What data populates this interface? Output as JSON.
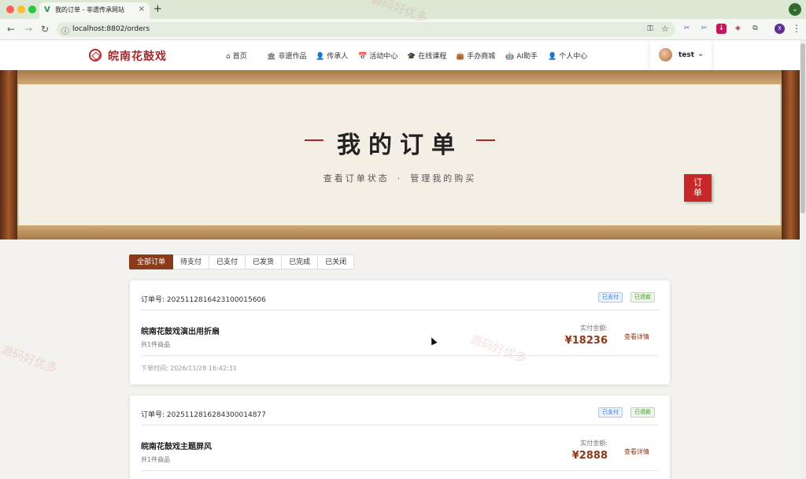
{
  "browser": {
    "tab_title": "我的订单 - 非遗传承网站",
    "tab_favicon": "V",
    "url": "localhost:8802/orders",
    "profile_initial": "X"
  },
  "header": {
    "logo_text": "皖南花鼓戏",
    "nav": [
      {
        "label": "首页",
        "icon": "⌂"
      },
      {
        "label": "非遗作品",
        "icon": "🏛"
      },
      {
        "label": "传承人",
        "icon": "👤"
      },
      {
        "label": "活动中心",
        "icon": "📅"
      },
      {
        "label": "在线课程",
        "icon": "🎓"
      },
      {
        "label": "手办商城",
        "icon": "👜"
      },
      {
        "label": "AI助手",
        "icon": "🤖"
      },
      {
        "label": "个人中心",
        "icon": "👤"
      }
    ],
    "username": "test"
  },
  "hero": {
    "title": "我的订单",
    "subtitle_left": "查看订单状态",
    "subtitle_sep": "·",
    "subtitle_right": "管理我的购买",
    "seal_line1": "订",
    "seal_line2": "单"
  },
  "filters": [
    "全部订单",
    "待支付",
    "已支付",
    "已发货",
    "已完成",
    "已关闭"
  ],
  "active_filter": "全部订单",
  "orders": [
    {
      "order_no": "订单号: 2025112816423100015606",
      "badge_paid": "已支付",
      "badge_refund": "已退款",
      "product": "皖南花鼓戏演出用折扇",
      "count": "共1件商品",
      "paid_label": "实付金额:",
      "amount": "¥18236",
      "detail": "查看详情",
      "time": "下单时间: 2026/11/28 16:42:31"
    },
    {
      "order_no": "订单号: 2025112816284300014877",
      "badge_paid": "已支付",
      "badge_refund": "已退款",
      "product": "皖南花鼓戏主题屏风",
      "count": "共1件商品",
      "paid_label": "实付金额:",
      "amount": "¥2888",
      "detail": "查看详情"
    }
  ],
  "watermark": "源码好优多",
  "colors": {
    "brand": "#8b3a1a",
    "logo": "#a52a2a",
    "seal": "#c62828",
    "badge_paid": "#3a7bd5",
    "badge_refund": "#3f9c2a"
  }
}
